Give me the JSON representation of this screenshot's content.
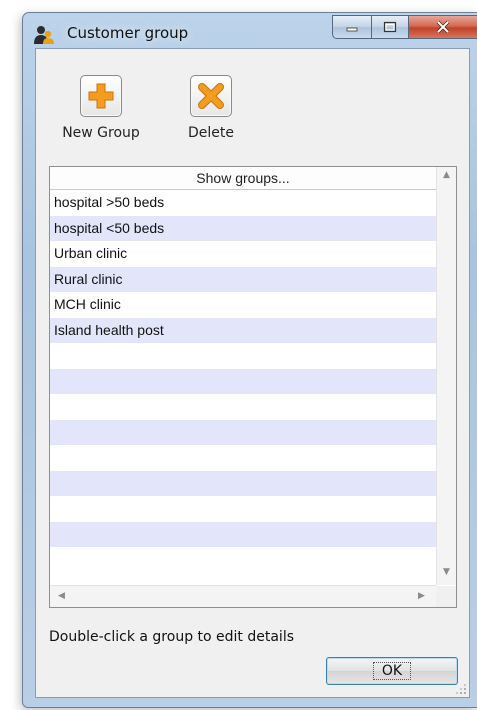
{
  "window": {
    "title": "Customer group",
    "controls": {
      "minimize_icon": "minimize-icon",
      "maximize_icon": "maximize-icon",
      "close_icon": "close-icon"
    }
  },
  "toolbar": {
    "new_group": {
      "label": "New Group",
      "icon": "plus-icon"
    },
    "delete": {
      "label": "Delete",
      "icon": "x-icon"
    }
  },
  "list": {
    "header": "Show groups...",
    "items": [
      "hospital >50 beds",
      "hospital <50 beds",
      "Urban clinic",
      "Rural clinic",
      "MCH clinic",
      "Island health post",
      "",
      "",
      "",
      "",
      "",
      "",
      "",
      "",
      "",
      ""
    ]
  },
  "footer": {
    "hint": "Double-click a group to edit details",
    "ok_label": "OK"
  },
  "colors": {
    "accent": "#f39c1f",
    "row_alt": "#e3e6fb",
    "close_red": "#c0422a"
  }
}
